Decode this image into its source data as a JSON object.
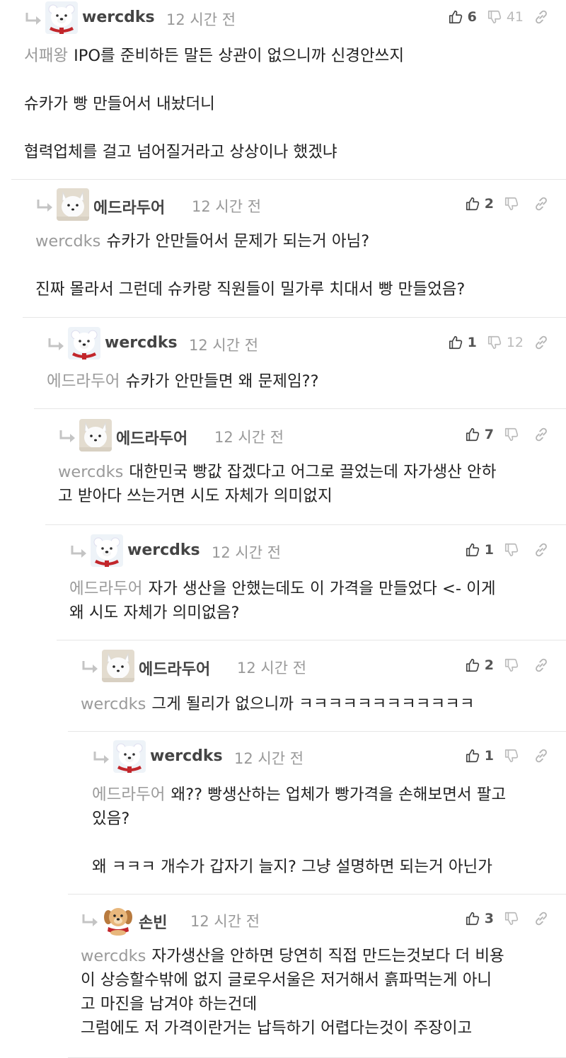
{
  "comments": [
    {
      "user": "wercdks",
      "avatar": "bear",
      "time": "12 시간 전",
      "up": "6",
      "down": "41",
      "mention": "서패왕",
      "text": [
        "IPO를 준비하든 말든 상관이 없으니까 신경안쓰지",
        "",
        "슈카가 빵 만들어서 내놨더니",
        "",
        "협력업체를 걸고 넘어질거라고 상상이나 했겠냐"
      ]
    },
    {
      "user": "에드라두어",
      "avatar": "fox",
      "time": "12 시간 전",
      "up": "2",
      "down": "",
      "mention": "wercdks",
      "text": [
        "슈카가 안만들어서 문제가 되는거 아님?",
        "",
        "진짜 몰라서 그런데 슈카랑 직원들이 밀가루 치대서 빵 만들었음?"
      ]
    },
    {
      "user": "wercdks",
      "avatar": "bear",
      "time": "12 시간 전",
      "up": "1",
      "down": "12",
      "mention": "에드라두어",
      "text": [
        "슈카가 안만들면 왜 문제임??"
      ]
    },
    {
      "user": "에드라두어",
      "avatar": "fox",
      "time": "12 시간 전",
      "up": "7",
      "down": "",
      "mention": "wercdks",
      "text": [
        "대한민국 빵값 잡겠다고 어그로 끌었는데 자가생산 안하",
        "고 받아다 쓰는거면 시도 자체가 의미없지"
      ]
    },
    {
      "user": "wercdks",
      "avatar": "bear",
      "time": "12 시간 전",
      "up": "1",
      "down": "",
      "mention": "에드라두어",
      "text": [
        "자가 생산을 안했는데도 이 가격을 만들었다 <- 이게",
        "왜 시도 자체가 의미없음?"
      ]
    },
    {
      "user": "에드라두어",
      "avatar": "fox",
      "time": "12 시간 전",
      "up": "2",
      "down": "",
      "mention": "wercdks",
      "text": [
        "그게 될리가 없으니까 ㅋㅋㅋㅋㅋㅋㅋㅋㅋㅋㅋㅋ"
      ]
    },
    {
      "user": "wercdks",
      "avatar": "bear",
      "time": "12 시간 전",
      "up": "1",
      "down": "",
      "mention": "에드라두어",
      "text": [
        "왜?? 빵생산하는 업체가 빵가격을 손해보면서 팔고",
        "있음?",
        "",
        "왜 ㅋㅋㅋ 개수가 갑자기 늘지? 그냥 설명하면 되는거 아닌가"
      ]
    },
    {
      "user": "손빈",
      "avatar": "dog",
      "time": "12 시간 전",
      "up": "3",
      "down": "",
      "mention": "wercdks",
      "text": [
        "자가생산을 안하면 당연히 직접 만드는것보다 더 비용",
        "이 상승할수밖에 없지 글로우서울은 저거해서 흙파먹는게 아니",
        "고 마진을 남겨야 하는건데",
        "그럼에도 저 가격이란거는 납득하기 어렵다는것이 주장이고"
      ]
    }
  ]
}
